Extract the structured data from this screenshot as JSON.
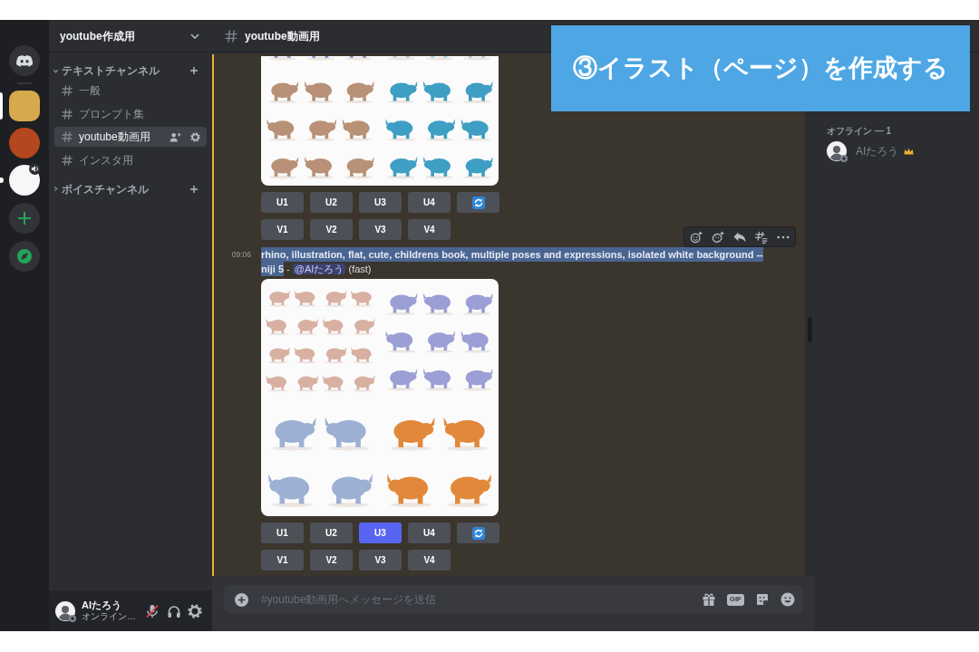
{
  "servers": [
    {
      "selected": true,
      "unread": false,
      "voice": false
    },
    {
      "selected": false,
      "unread": false,
      "voice": false
    },
    {
      "selected": false,
      "unread": true,
      "voice": true
    }
  ],
  "sidebar": {
    "server_name": "youtube作成用",
    "categories": [
      {
        "name": "テキストチャンネル",
        "expanded": true,
        "channels": [
          {
            "name": "一般",
            "selected": false
          },
          {
            "name": "プロンプト集",
            "selected": false
          },
          {
            "name": "youtube動画用",
            "selected": true
          },
          {
            "name": "インスタ用",
            "selected": false
          }
        ]
      },
      {
        "name": "ボイスチャンネル",
        "expanded": false
      }
    ]
  },
  "user_panel": {
    "name": "AIたろう",
    "status": "オンライン…",
    "mic_muted": true
  },
  "channel_header": {
    "name": "youtube動画用"
  },
  "messages": [
    {
      "mentions_you": true,
      "button_rows": [
        [
          {
            "kind": "text",
            "label": "U1",
            "selected": false
          },
          {
            "kind": "text",
            "label": "U2",
            "selected": false
          },
          {
            "kind": "text",
            "label": "U3",
            "selected": false
          },
          {
            "kind": "text",
            "label": "U4",
            "selected": false
          },
          {
            "kind": "refresh",
            "selected": false
          }
        ],
        [
          {
            "kind": "text",
            "label": "V1",
            "selected": false
          },
          {
            "kind": "text",
            "label": "V2",
            "selected": false
          },
          {
            "kind": "text",
            "label": "V3",
            "selected": false
          },
          {
            "kind": "text",
            "label": "V4",
            "selected": false
          }
        ]
      ]
    },
    {
      "mentions_you": true,
      "hovered": true,
      "time": "09:06",
      "prompt": "rhino, illustration, flat, cute, childrens book, multiple poses and expressions, isolated white background --niji 5",
      "prompt_selected": true,
      "separator": "-",
      "mention": "@AIたろう",
      "speed": "(fast)",
      "button_rows": [
        [
          {
            "kind": "text",
            "label": "U1",
            "selected": false
          },
          {
            "kind": "text",
            "label": "U2",
            "selected": false
          },
          {
            "kind": "text",
            "label": "U3",
            "selected": true
          },
          {
            "kind": "text",
            "label": "U4",
            "selected": false
          },
          {
            "kind": "refresh",
            "selected": false
          }
        ],
        [
          {
            "kind": "text",
            "label": "V1",
            "selected": false
          },
          {
            "kind": "text",
            "label": "V2",
            "selected": false
          },
          {
            "kind": "text",
            "label": "V3",
            "selected": false
          },
          {
            "kind": "text",
            "label": "V4",
            "selected": false
          }
        ]
      ]
    }
  ],
  "composer": {
    "placeholder": "#youtube動画用へメッセージを送信",
    "gif_label": "GIF"
  },
  "members": {
    "groups": [
      {
        "title": "オフライン — 1",
        "members": [
          {
            "name": "AIたろう",
            "owner": true
          }
        ]
      }
    ]
  },
  "overlay_caption": "③イラスト（ページ）を作成する"
}
